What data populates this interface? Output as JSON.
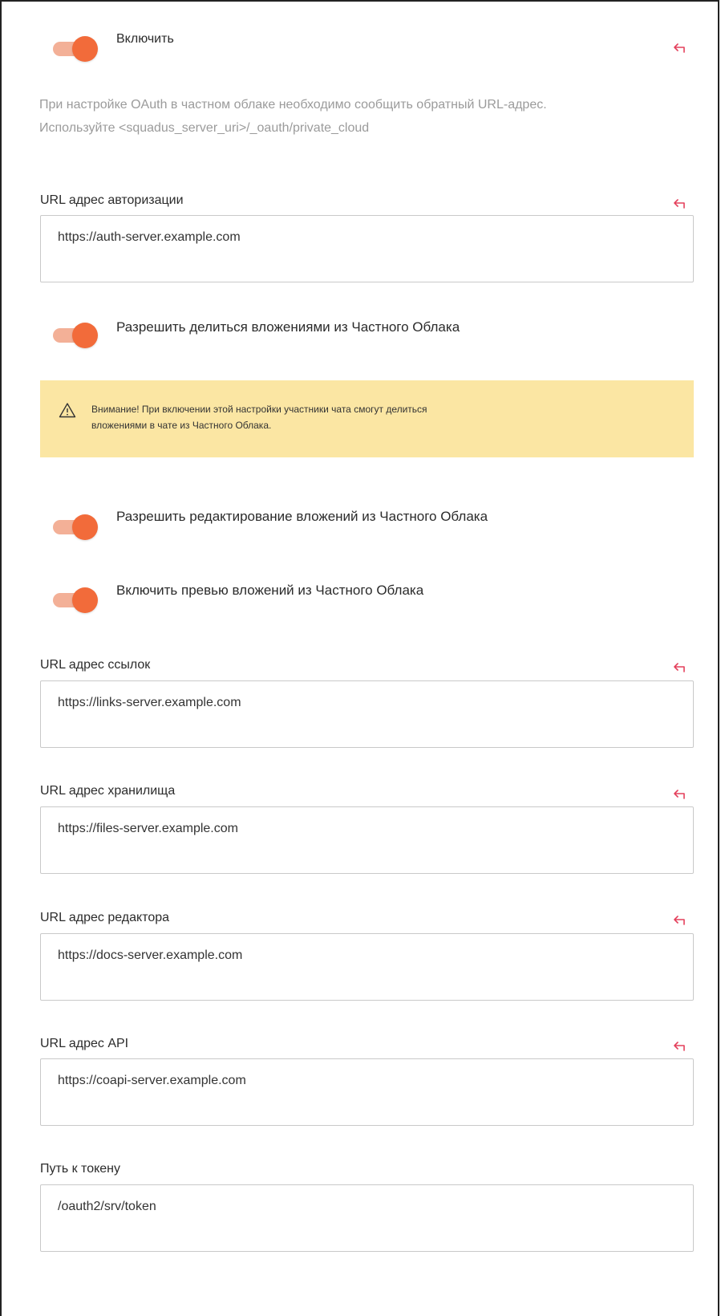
{
  "enable": {
    "label": "Включить",
    "checked": true
  },
  "hint": {
    "line1": "При настройке OAuth в частном облаке необходимо сообщить обратный URL-адрес.",
    "line2": "Используйте <squadus_server_uri>/_oauth/private_cloud"
  },
  "auth_url": {
    "label": "URL адрес авторизации",
    "value": "https://auth-server.example.com"
  },
  "allow_share": {
    "label": "Разрешить делиться вложениями из Частного Облака",
    "checked": true
  },
  "warning": {
    "line1": "Внимание! При включении этой настройки участники чата смогут делиться",
    "line2": "вложениями в чате из Частного Облака.",
    "icon": "warning-triangle-icon"
  },
  "allow_edit": {
    "label": "Разрешить редактирование вложений из Частного Облака",
    "checked": true
  },
  "enable_preview": {
    "label": "Включить превью вложений из Частного Облака",
    "checked": true
  },
  "links_url": {
    "label": "URL адрес ссылок",
    "value": "https://links-server.example.com"
  },
  "storage_url": {
    "label": "URL адрес хранилища",
    "value": "https://files-server.example.com"
  },
  "editor_url": {
    "label": "URL адрес редактора",
    "value": "https://docs-server.example.com"
  },
  "api_url": {
    "label": "URL адрес API",
    "value": "https://coapi-server.example.com"
  },
  "token_path": {
    "label": "Путь к токену",
    "value": "/oauth2/srv/token"
  },
  "colors": {
    "accent": "#f26b3a",
    "accent_light": "#f3b097",
    "reset_icon": "#e4405c",
    "warning_bg": "#fbe6a3",
    "hint_text": "#9b9b9b"
  }
}
